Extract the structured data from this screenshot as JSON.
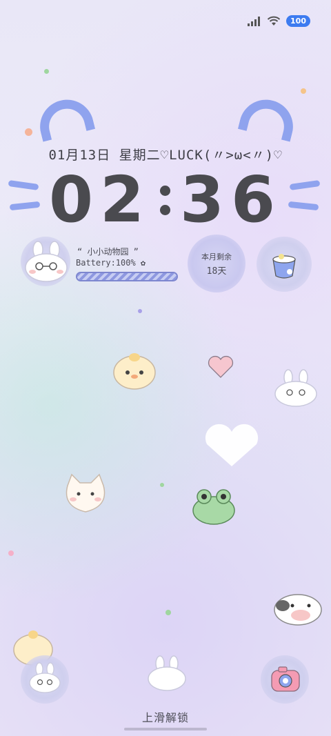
{
  "status_bar": {
    "battery": "100",
    "signal_icon": "cellular-signal-icon",
    "wifi_icon": "wifi-icon"
  },
  "lockscreen": {
    "date_line": "01月13日 星期二♡LUCK(〃>ω<〃)♡",
    "time_hours": "02",
    "time_minutes": "36"
  },
  "widgets": {
    "zoo": {
      "title": "“ 小小动物园 ”",
      "battery_label": "Battery:100% ✿",
      "battery_level": 1.0
    },
    "month_remaining": {
      "label": "本月剩余",
      "value": "18天"
    }
  },
  "shortcuts": {
    "left_icon": "bunny-shortcut-icon",
    "right_icon": "camera-shortcut-icon"
  },
  "unlock_hint": "上滑解锁",
  "colors": {
    "accent_blue": "#8fa3ee",
    "battery_pill": "#3d7bf0",
    "text_dark": "#4a4a4f"
  }
}
